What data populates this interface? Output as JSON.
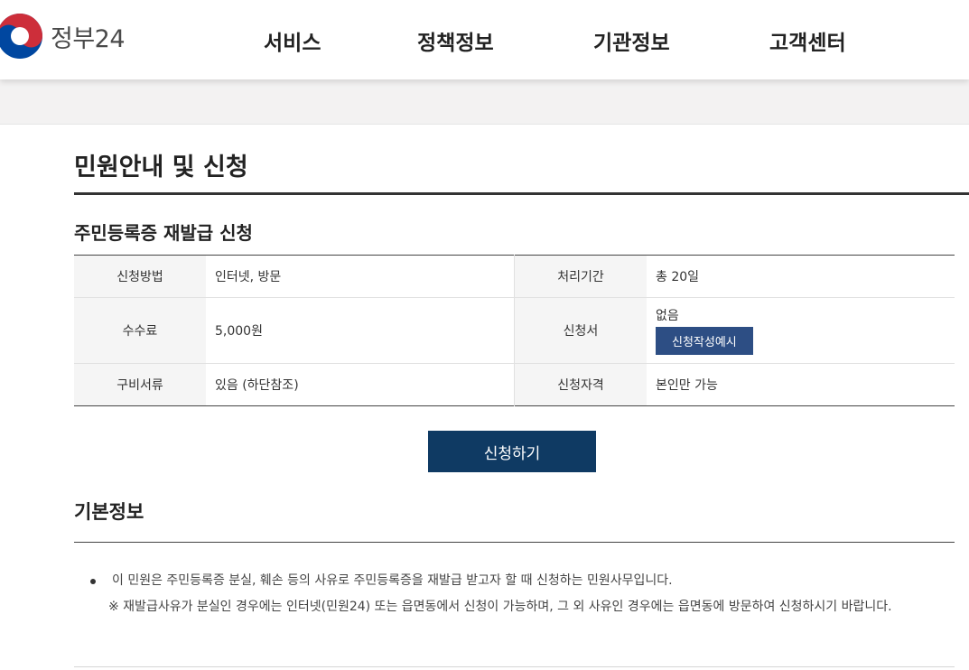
{
  "header": {
    "logo_text": "정부24",
    "nav": [
      "서비스",
      "정책정보",
      "기관정보",
      "고객센터"
    ]
  },
  "page_title": "민원안내 및 신청",
  "service_title": "주민등록증 재발급 신청",
  "info_table": {
    "rows": [
      {
        "label1": "신청방법",
        "value1": "인터넷, 방문",
        "label2": "처리기간",
        "value2": "총 20일"
      },
      {
        "label1": "수수료",
        "value1": "5,000원",
        "label2": "신청서",
        "value2": "없음",
        "button": "신청작성예시"
      },
      {
        "label1": "구비서류",
        "value1": "있음 (하단참조)",
        "label2": "신청자격",
        "value2": "본인만 가능"
      }
    ]
  },
  "apply_button": "신청하기",
  "basic_info": {
    "title": "기본정보",
    "line1": "이 민원은 주민등록증 분실, 훼손 등의 사유로 주민등록증을 재발급 받고자 할 때 신청하는 민원사무입니다.",
    "line2": "※ 재발급사유가 분실인 경우에는 인터넷(민원24) 또는 읍면동에서 신청이 가능하며, 그 외 사유인 경우에는 읍면동에 방문하여 신청하시기 바랍니다."
  },
  "colors": {
    "brand_blue": "#0f3a63",
    "button_blue": "#2d4e84",
    "logo_red": "#cd2e3a",
    "logo_blue": "#0047a0"
  }
}
